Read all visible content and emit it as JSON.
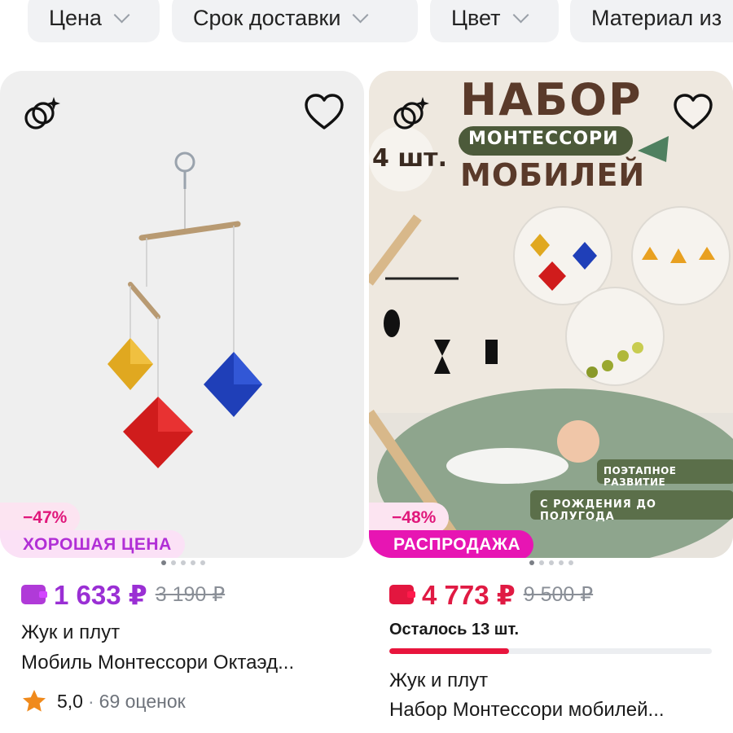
{
  "filters": [
    {
      "label": "Цена"
    },
    {
      "label": "Срок доставки"
    },
    {
      "label": "Цвет"
    },
    {
      "label": "Материал из"
    }
  ],
  "products": [
    {
      "discount": "−47%",
      "tag": "ХОРОШАЯ ЦЕНА",
      "price": "1 633 ₽",
      "old_price": "3 190 ₽",
      "brand": "Жук и плут",
      "title": "Мобиль Монтессори Октаэд...",
      "rating": "5,0",
      "rating_sep": "·",
      "reviews": "69 оценок",
      "accent": "#9a2fd4"
    },
    {
      "discount": "−48%",
      "tag": "РАСПРОДАЖА",
      "price": "4 773 ₽",
      "old_price": "9 500 ₽",
      "stock": "Осталось 13 шт.",
      "stock_level": 0.37,
      "brand": "Жук и плут",
      "title": "Набор Монтессори мобилей...",
      "accent": "#e01a43",
      "image_text": {
        "headline1": "НАБОР",
        "headline2": "МОНТЕССОРИ",
        "headline3": "МОБИЛЕЙ",
        "count": "4 шт.",
        "caption1": "ПОЭТАПНОЕ РАЗВИТИЕ",
        "caption2": "С РОЖДЕНИЯ ДО ПОЛУГОДА"
      }
    }
  ]
}
